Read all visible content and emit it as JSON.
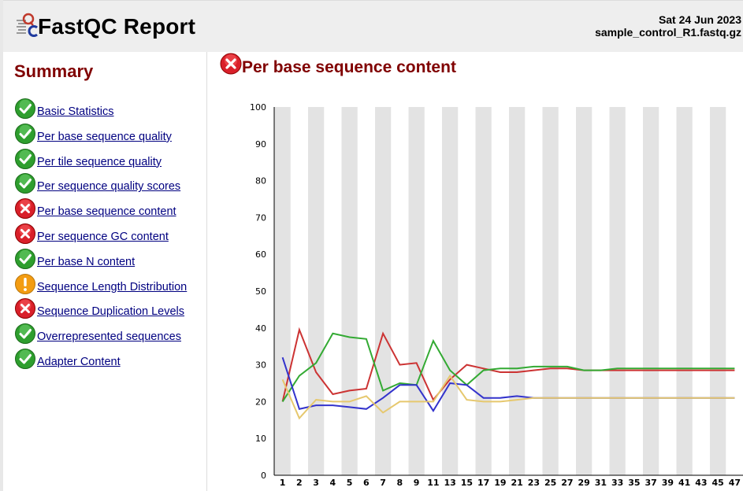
{
  "header": {
    "title": "FastQC Report",
    "date": "Sat 24 Jun 2023",
    "filename": "sample_control_R1.fastq.gz"
  },
  "summary": {
    "heading": "Summary",
    "items": [
      {
        "label": "Basic Statistics",
        "status": "pass"
      },
      {
        "label": "Per base sequence quality",
        "status": "pass"
      },
      {
        "label": "Per tile sequence quality",
        "status": "pass"
      },
      {
        "label": "Per sequence quality scores",
        "status": "pass"
      },
      {
        "label": "Per base sequence content",
        "status": "fail"
      },
      {
        "label": "Per sequence GC content",
        "status": "fail"
      },
      {
        "label": "Per base N content",
        "status": "pass"
      },
      {
        "label": "Sequence Length Distribution",
        "status": "warn"
      },
      {
        "label": "Sequence Duplication Levels",
        "status": "fail"
      },
      {
        "label": "Overrepresented sequences",
        "status": "pass"
      },
      {
        "label": "Adapter Content",
        "status": "pass"
      }
    ]
  },
  "module": {
    "title": "Per base sequence content",
    "status": "fail"
  },
  "colors": {
    "pass": "#2e9e2e",
    "warn": "#f39c12",
    "fail": "#d9202a",
    "heading": "#800000",
    "link": "#000080"
  },
  "chart_data": {
    "type": "line",
    "x": [
      "1",
      "2",
      "3",
      "4",
      "5",
      "6",
      "7",
      "8",
      "9",
      "10-11",
      "12-13",
      "14-15",
      "16-17",
      "18-19",
      "20-21",
      "22-23",
      "24-25",
      "26-27",
      "28-29",
      "30-31",
      "32-33",
      "34-35",
      "36-37",
      "38-39",
      "40-41",
      "42-43",
      "44-45",
      "46-47"
    ],
    "x_tick_labels": [
      "1",
      "2",
      "3",
      "4",
      "5",
      "6",
      "7",
      "8",
      "9",
      "11",
      "13",
      "15",
      "17",
      "19",
      "21",
      "23",
      "25",
      "27",
      "29",
      "31",
      "33",
      "35",
      "37",
      "39",
      "41",
      "43",
      "45",
      "47"
    ],
    "ylim": [
      0,
      100
    ],
    "y_ticks": [
      0,
      10,
      20,
      30,
      40,
      50,
      60,
      70,
      80,
      90,
      100
    ],
    "grid": "alternating vertical bands",
    "series": [
      {
        "color": "#cc3333",
        "values": [
          20,
          39.5,
          28,
          22,
          23,
          23.5,
          38.5,
          30,
          30.5,
          20.5,
          26,
          30,
          29,
          28,
          28,
          28.5,
          29,
          29,
          28.5,
          28.5,
          28.5,
          28.5,
          28.5,
          28.5,
          28.5,
          28.5,
          28.5,
          28.5
        ]
      },
      {
        "color": "#33aa33",
        "values": [
          20,
          27,
          30.5,
          38.5,
          37.5,
          37,
          23,
          25,
          24.5,
          36.5,
          28.5,
          24.5,
          28.5,
          29,
          29,
          29.5,
          29.5,
          29.5,
          28.5,
          28.5,
          29,
          29,
          29,
          29,
          29,
          29,
          29,
          29
        ]
      },
      {
        "color": "#3333cc",
        "values": [
          32,
          18,
          19,
          19,
          18.5,
          18,
          21,
          24.5,
          24.5,
          17.5,
          25,
          24.5,
          21,
          21,
          21.5,
          21,
          21,
          21,
          21,
          21,
          21,
          21,
          21,
          21,
          21,
          21,
          21,
          21
        ]
      },
      {
        "color": "#e6c86e",
        "values": [
          26,
          15.5,
          20.5,
          20,
          20,
          21.5,
          17,
          20,
          20,
          20,
          27,
          20.5,
          20,
          20,
          20.5,
          21,
          21,
          21,
          21,
          21,
          21,
          21,
          21,
          21,
          21,
          21,
          21,
          21
        ]
      }
    ]
  }
}
